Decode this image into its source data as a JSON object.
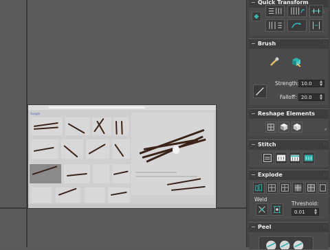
{
  "panel": {
    "quick_transform": {
      "title": "Quick Transform"
    },
    "brush": {
      "title": "Brush",
      "strength_label": "Strength:",
      "strength_value": "10.0",
      "falloff_label": "Falloff:",
      "falloff_value": "20.0"
    },
    "reshape": {
      "title": "Reshape Elements"
    },
    "stitch": {
      "title": "Stitch"
    },
    "explode": {
      "title": "Explode",
      "weld_label": "Weld",
      "threshold_label": "Threshold:",
      "threshold_value": "0.01"
    },
    "peel": {
      "title": "Peel"
    }
  },
  "browser": {
    "logo": "Google"
  },
  "colors": {
    "accent": "#2fb4b0",
    "panel_bg": "#444444",
    "viewport_bg": "#5b5b5b"
  }
}
